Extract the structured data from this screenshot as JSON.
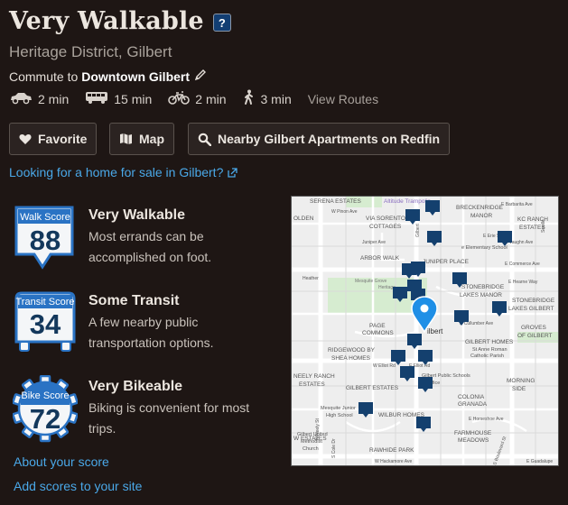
{
  "header": {
    "title": "Very Walkable",
    "help_label": "?"
  },
  "location": "Heritage District, Gilbert",
  "commute": {
    "prefix": "Commute to",
    "destination": "Downtown Gilbert"
  },
  "modes": [
    {
      "icon": "car-icon",
      "time": "2 min"
    },
    {
      "icon": "bus-icon",
      "time": "15 min"
    },
    {
      "icon": "bike-icon",
      "time": "2 min"
    },
    {
      "icon": "walk-icon",
      "time": "3 min"
    }
  ],
  "view_routes": "View Routes",
  "buttons": {
    "favorite": "Favorite",
    "map": "Map",
    "nearby": "Nearby Gilbert Apartments on Redfin"
  },
  "home_link": "Looking for a home for sale in Gilbert?",
  "scores": [
    {
      "badge_label": "Walk Score",
      "value": "88",
      "heading": "Very Walkable",
      "lines": [
        "Most errands can be",
        "accomplished on foot."
      ]
    },
    {
      "badge_label": "Transit Score",
      "value": "34",
      "heading": "Some Transit",
      "lines": [
        "A few nearby public",
        "transportation options."
      ]
    },
    {
      "badge_label": "Bike Score",
      "value": "72",
      "heading": "Very Bikeable",
      "lines": [
        "Biking is convenient for most",
        "trips."
      ]
    }
  ],
  "footer_links": {
    "about": "About your score",
    "add": "Add scores to your site"
  },
  "map": {
    "labels": {
      "serena": "SERENA ESTATES",
      "altitude": "Altitude Trampolin",
      "barbarita": "E Barbarita Ave",
      "breckenridge": "BRECKENRIDGE",
      "manor1": "MANOR",
      "kc": "KC RANCH",
      "estates1": "ESTATES",
      "golden": "OLDEN",
      "pinon": "W Pinon Ave",
      "via": "VIA SORENTO",
      "cottages": "COTTAGES",
      "erie": "E Erie St",
      "elementary": "e Elementary School",
      "vaughn": "E Vaughn Ave",
      "juniper_ave": "Juniper Ave",
      "arbor": "ARBOR WALK",
      "juniper_place": "JUNIPER PLACE",
      "commerce": "E Commerce Ave",
      "heather": "Heather",
      "mesquite_grove": "Mesquite Grove",
      "heritage": "Heritage",
      "stonebridge_lakes": "STONEBRIDGE",
      "lakes_manor": "LAKES MANOR",
      "hearne": "E Hearne Way",
      "stonebridge": "STONEBRIDGE",
      "lakes_gilbert": "LAKES GILBERT",
      "page": "PAGE",
      "commons": "COMMONS",
      "gilbert": "ilbert",
      "groves": "GROVES",
      "of_gilbert": "OF GILBERT",
      "cullumber": "E Cullumber Ave",
      "gilbert_homes": "GILBERT HOMES",
      "st_anne": "St Anne Roman",
      "catholic": "Catholic Parish",
      "ridgewood": "RIDGEWOOD BY",
      "shea": "SHEA HOMES",
      "neely_ranch": "NEELY RANCH",
      "neely_estates": "ESTATES",
      "elliot": "E Elliot Rd",
      "w_elliot": "W Elliot Rd",
      "gilbert_estates": "GILBERT ESTATES",
      "public_schools": "Gilbert Public Schools",
      "office": "Office",
      "morning": "MORNING",
      "side": "SIDE",
      "colonia": "COLONIA",
      "granada": "GRANADA",
      "mesquite_junior": "Mesquite Junior",
      "high_school": "High School",
      "wilbur": "WILBUR HOMES",
      "horseshoe": "E Horseshoe Ave",
      "farmhouse": "FARMHOUSE",
      "meadows": "MEADOWS",
      "gilbert_united": "Gilbert United",
      "methodist": "Methodist",
      "church": "Church",
      "westates": "W ESTATES",
      "rawhide": "RAWHIDE PARK",
      "hackamore": "W Hackamore Ave",
      "guadalupe": "E Guadalupe",
      "gilbert_rd": "Gilbert",
      "neely_st": "N Neely St",
      "cole": "S Cole Dr",
      "seville": "Seville",
      "boulevard": "S Boulevard St"
    }
  }
}
